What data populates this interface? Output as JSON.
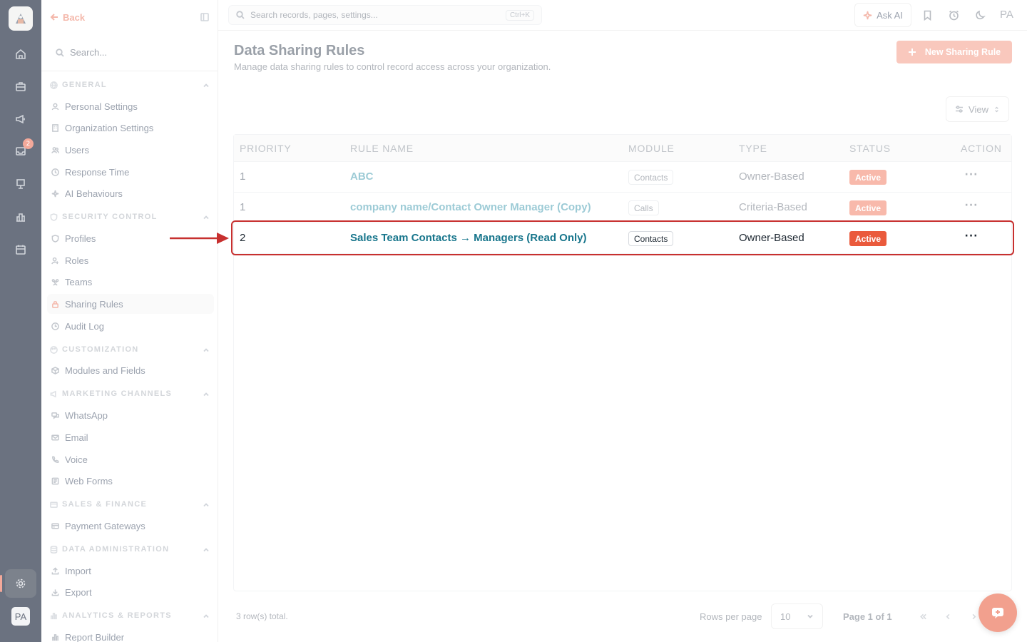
{
  "rail": {
    "badge_count": "2",
    "avatar": "PA",
    "icons": [
      "home-icon",
      "briefcase-icon",
      "megaphone-icon",
      "inbox-icon",
      "presentation-icon",
      "chart-icon",
      "calendar-icon",
      "settings-icon"
    ]
  },
  "sidebar": {
    "back_label": "Back",
    "search_placeholder": "Search...",
    "groups": [
      {
        "label": "GENERAL",
        "items": [
          "Personal Settings",
          "Organization Settings",
          "Users",
          "Response Time",
          "AI Behaviours"
        ]
      },
      {
        "label": "SECURITY CONTROL",
        "items": [
          "Profiles",
          "Roles",
          "Teams",
          "Sharing Rules",
          "Audit Log"
        ]
      },
      {
        "label": "CUSTOMIZATION",
        "items": [
          "Modules and Fields"
        ]
      },
      {
        "label": "MARKETING CHANNELS",
        "items": [
          "WhatsApp",
          "Email",
          "Voice",
          "Web Forms"
        ]
      },
      {
        "label": "SALES & FINANCE",
        "items": [
          "Payment Gateways"
        ]
      },
      {
        "label": "DATA ADMINISTRATION",
        "items": [
          "Import",
          "Export"
        ]
      },
      {
        "label": "ANALYTICS & REPORTS",
        "items": [
          "Report Builder"
        ]
      }
    ],
    "active_item": "Sharing Rules"
  },
  "topbar": {
    "search_placeholder": "Search records, pages, settings...",
    "shortcut": "Ctrl+K",
    "ask_ai_label": "Ask AI",
    "avatar": "PA"
  },
  "page": {
    "title": "Data Sharing Rules",
    "subtitle": "Manage data sharing rules to control record access across your organization.",
    "new_button_label": "New Sharing Rule",
    "view_button_label": "View"
  },
  "table": {
    "headers": {
      "priority": "PRIORITY",
      "rule_name": "RULE NAME",
      "module": "MODULE",
      "type": "TYPE",
      "status": "STATUS",
      "action": "ACTION"
    },
    "rows": [
      {
        "priority": "1",
        "rule_name": "ABC",
        "module": "Contacts",
        "type": "Owner-Based",
        "status": "Active",
        "action": "···"
      },
      {
        "priority": "1",
        "rule_name": "company name/Contact Owner Manager (Copy)",
        "module": "Calls",
        "type": "Criteria-Based",
        "status": "Active",
        "action": "···"
      },
      {
        "priority": "2",
        "rule_name": "Sales Team Contacts → Managers (Read Only)",
        "module": "Contacts",
        "type": "Owner-Based",
        "status": "Active",
        "action": "···"
      }
    ],
    "highlighted_row": 2
  },
  "footer": {
    "row_count": "3 row(s) total.",
    "rows_per_page_label": "Rows per page",
    "rows_per_page_value": "10",
    "page_info": "Page 1 of 1"
  },
  "colors": {
    "accent": "#f2a08e",
    "highlight_border": "#c7302f",
    "status_active": "#ea5a3c",
    "link": "#18768c"
  }
}
